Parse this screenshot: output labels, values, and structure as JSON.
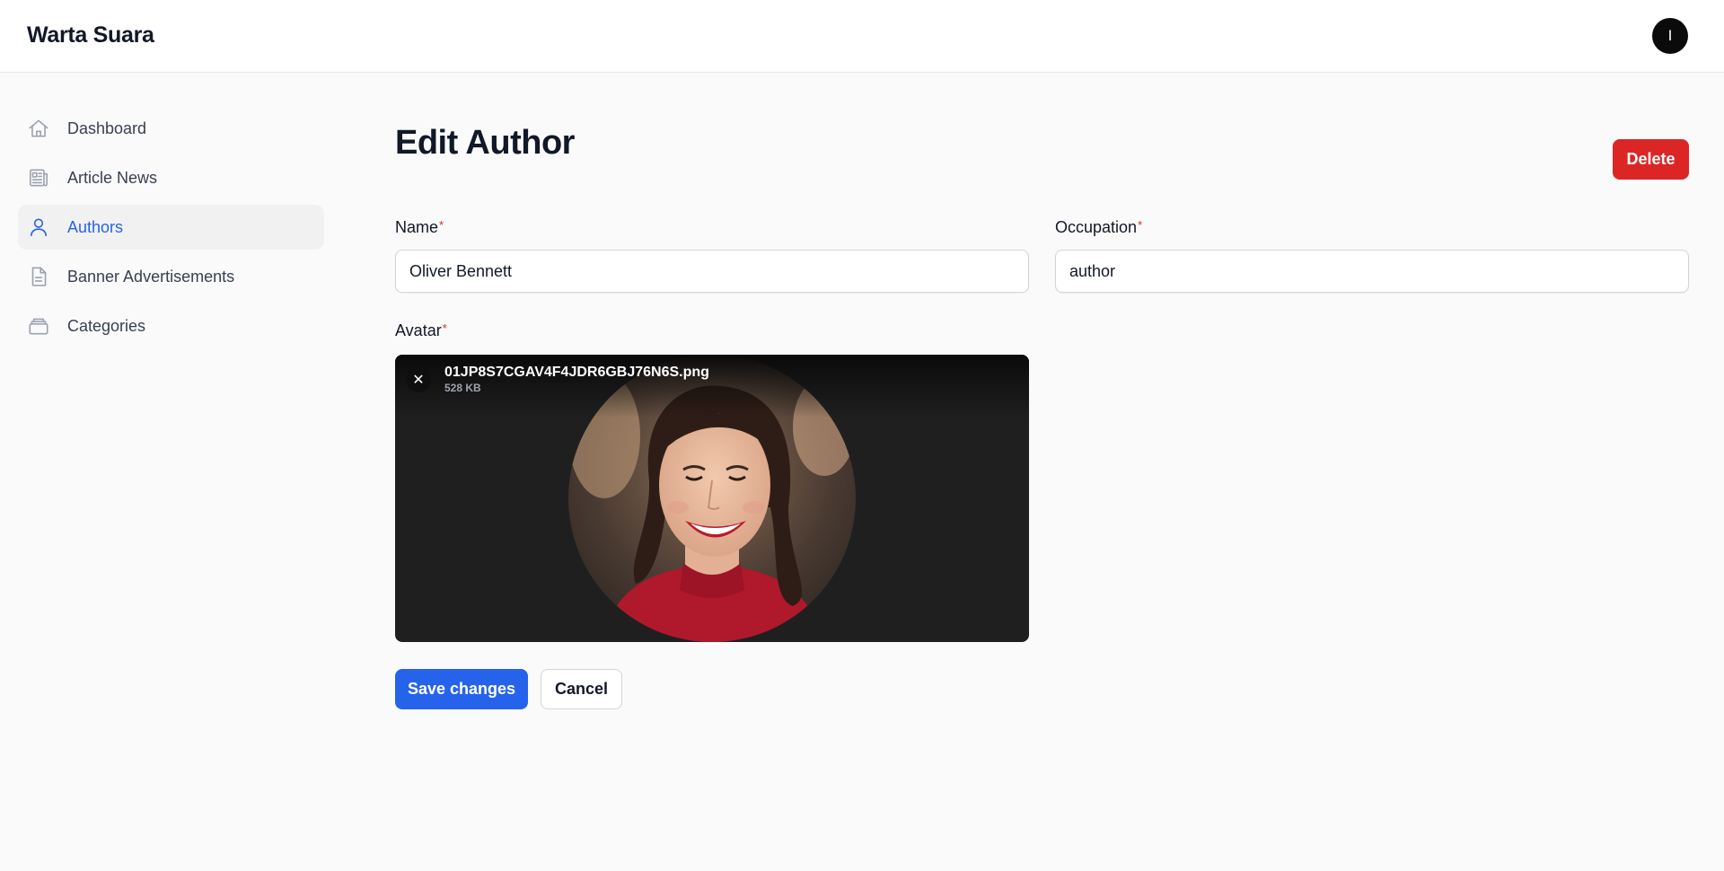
{
  "app": {
    "brand": "Warta Suara",
    "user_initial": "I"
  },
  "sidebar": {
    "items": [
      {
        "label": "Dashboard",
        "icon": "home-icon",
        "active": false
      },
      {
        "label": "Article News",
        "icon": "newspaper-icon",
        "active": false
      },
      {
        "label": "Authors",
        "icon": "user-icon",
        "active": true
      },
      {
        "label": "Banner Advertisements",
        "icon": "document-icon",
        "active": false
      },
      {
        "label": "Categories",
        "icon": "rectangle-stack-icon",
        "active": false
      }
    ]
  },
  "page": {
    "title": "Edit Author",
    "delete_label": "Delete"
  },
  "form": {
    "name": {
      "label": "Name",
      "required_mark": "*",
      "value": "Oliver Bennett"
    },
    "occupation": {
      "label": "Occupation",
      "required_mark": "*",
      "value": "author"
    },
    "avatar": {
      "label": "Avatar",
      "required_mark": "*",
      "file_name": "01JP8S7CGAV4F4JDR6GBJ76N6S.png",
      "file_size": "528 KB",
      "remove_glyph": "✕"
    },
    "save_label": "Save changes",
    "cancel_label": "Cancel"
  },
  "colors": {
    "primary": "#2563eb",
    "danger": "#dc2626",
    "upload_bg": "#1f1f1f"
  }
}
